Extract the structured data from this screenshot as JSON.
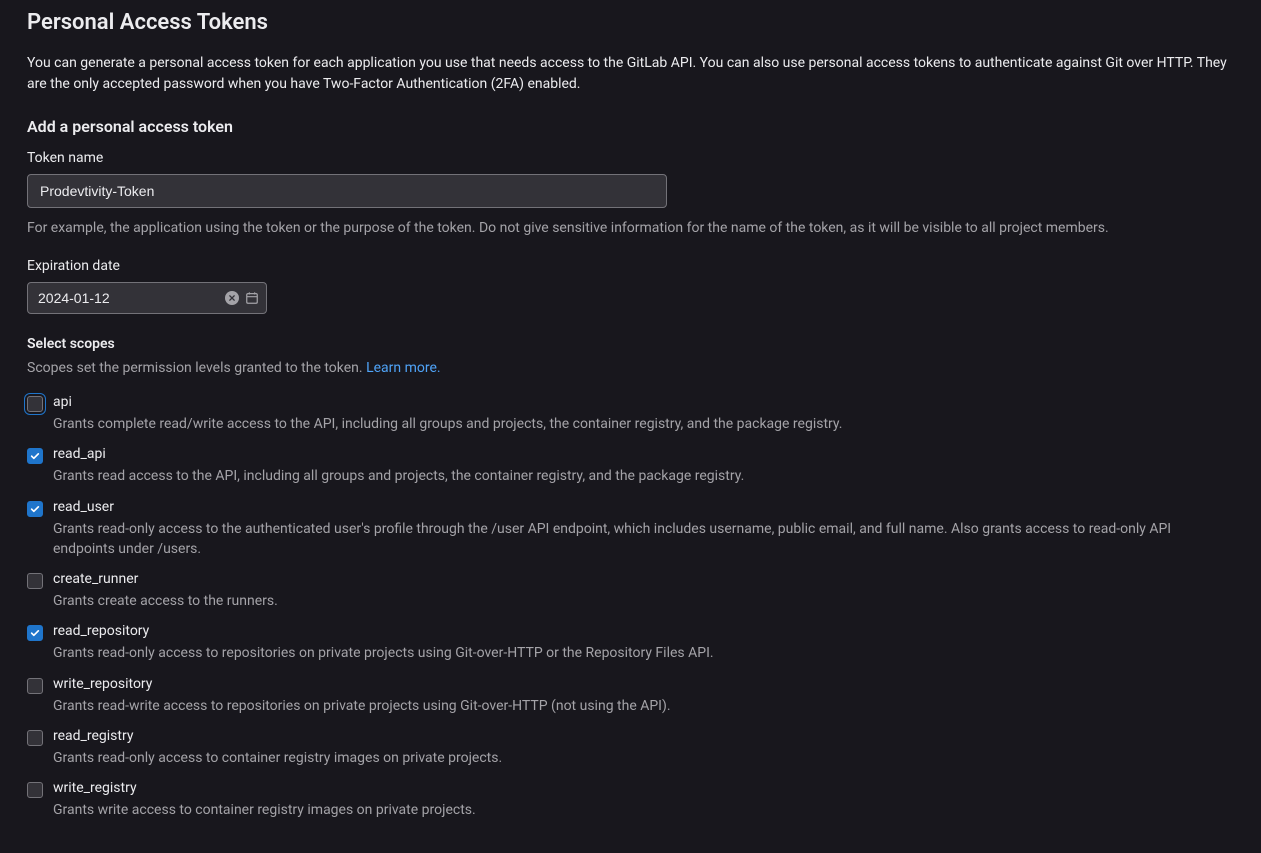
{
  "page": {
    "title": "Personal Access Tokens",
    "description": "You can generate a personal access token for each application you use that needs access to the GitLab API. You can also use personal access tokens to authenticate against Git over HTTP. They are the only accepted password when you have Two-Factor Authentication (2FA) enabled."
  },
  "form": {
    "heading": "Add a personal access token",
    "tokenName": {
      "label": "Token name",
      "value": "Prodevtivity-Token",
      "helper": "For example, the application using the token or the purpose of the token. Do not give sensitive information for the name of the token, as it will be visible to all project members."
    },
    "expiration": {
      "label": "Expiration date",
      "value": "2024-01-12"
    },
    "scopes": {
      "label": "Select scopes",
      "helper": "Scopes set the permission levels granted to the token. ",
      "learnMore": "Learn more.",
      "items": [
        {
          "name": "api",
          "checked": false,
          "focus": true,
          "desc": "Grants complete read/write access to the API, including all groups and projects, the container registry, and the package registry."
        },
        {
          "name": "read_api",
          "checked": true,
          "focus": false,
          "desc": "Grants read access to the API, including all groups and projects, the container registry, and the package registry."
        },
        {
          "name": "read_user",
          "checked": true,
          "focus": false,
          "desc": "Grants read-only access to the authenticated user's profile through the /user API endpoint, which includes username, public email, and full name. Also grants access to read-only API endpoints under /users."
        },
        {
          "name": "create_runner",
          "checked": false,
          "focus": false,
          "desc": "Grants create access to the runners."
        },
        {
          "name": "read_repository",
          "checked": true,
          "focus": false,
          "desc": "Grants read-only access to repositories on private projects using Git-over-HTTP or the Repository Files API."
        },
        {
          "name": "write_repository",
          "checked": false,
          "focus": false,
          "desc": "Grants read-write access to repositories on private projects using Git-over-HTTP (not using the API)."
        },
        {
          "name": "read_registry",
          "checked": false,
          "focus": false,
          "desc": "Grants read-only access to container registry images on private projects."
        },
        {
          "name": "write_registry",
          "checked": false,
          "focus": false,
          "desc": "Grants write access to container registry images on private projects."
        }
      ]
    }
  }
}
